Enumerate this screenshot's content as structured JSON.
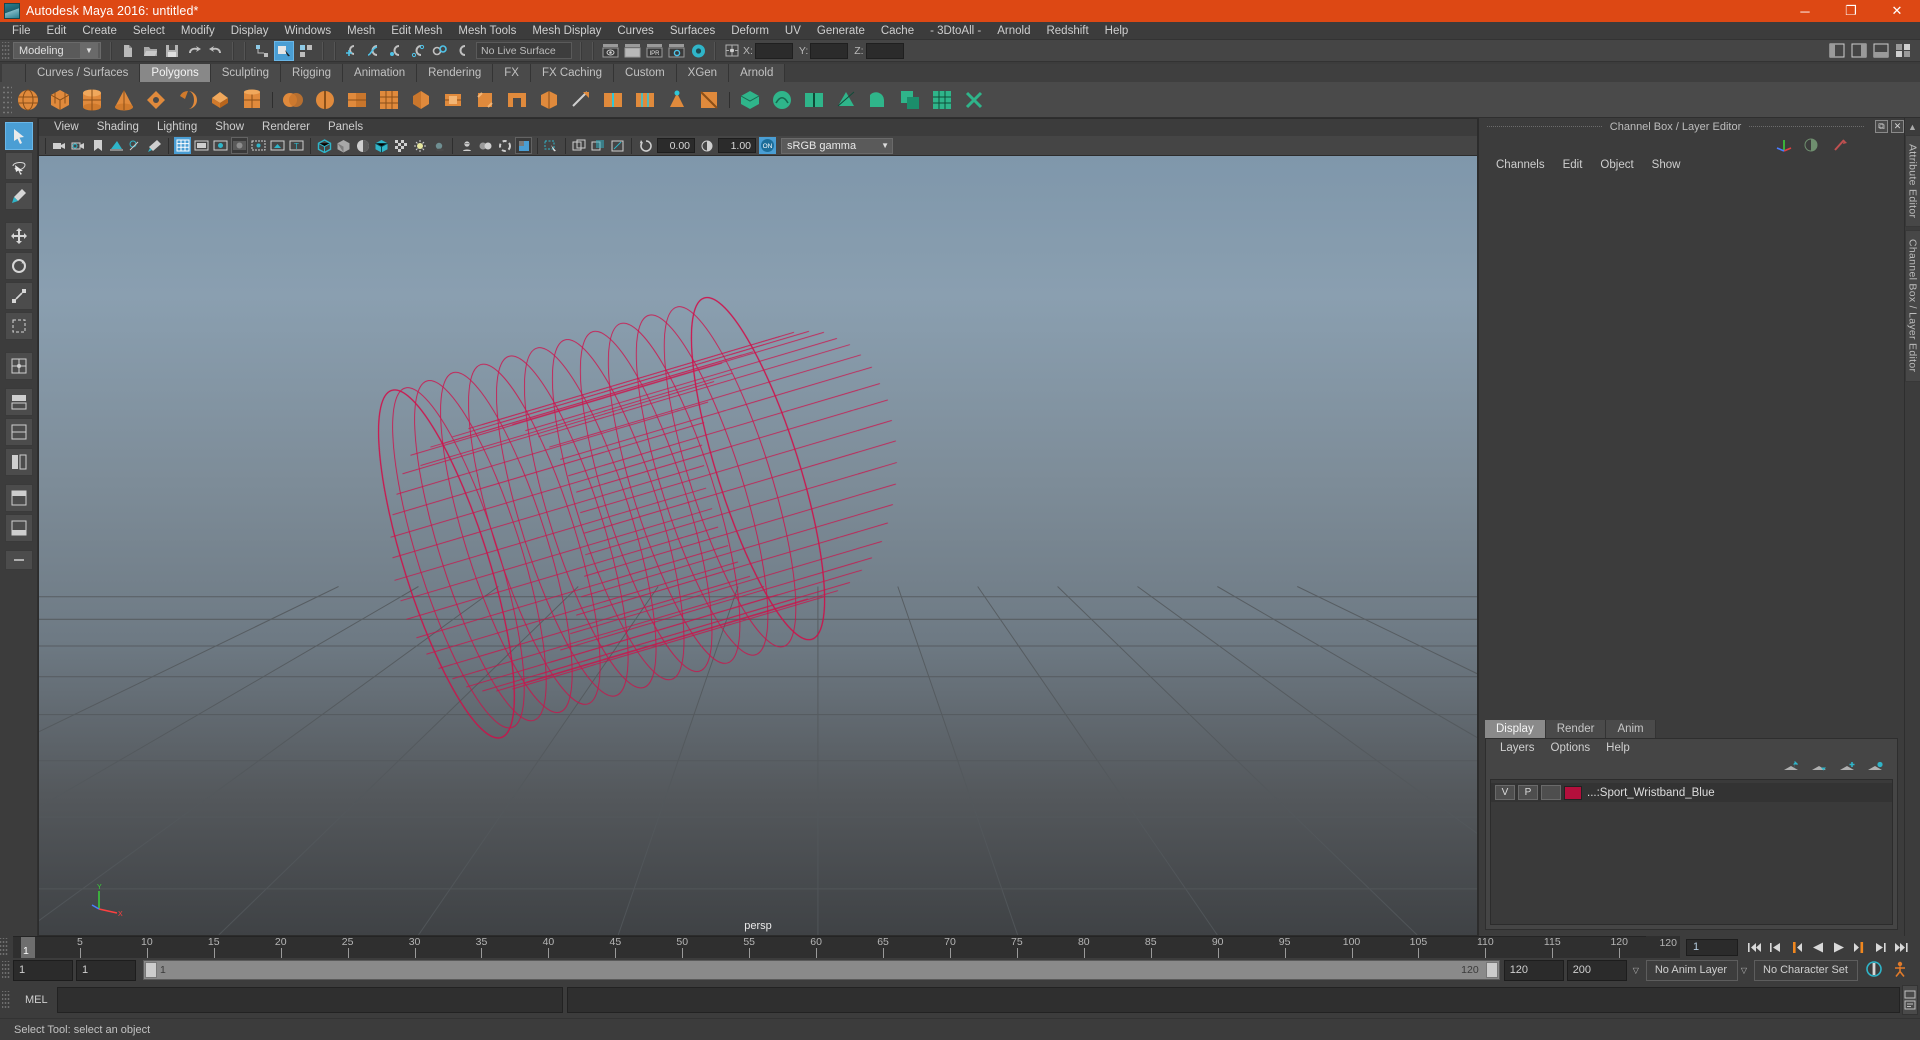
{
  "window": {
    "title": "Autodesk Maya 2016: untitled*",
    "app_icon": "maya-logo-icon",
    "controls": {
      "minimize": "─",
      "maximize": "❐",
      "close": "✕"
    },
    "accent_color": "#dd4814"
  },
  "menubar": {
    "items": [
      "File",
      "Edit",
      "Create",
      "Select",
      "Modify",
      "Display",
      "Windows",
      "Mesh",
      "Edit Mesh",
      "Mesh Tools",
      "Mesh Display",
      "Curves",
      "Surfaces",
      "Deform",
      "UV",
      "Generate",
      "Cache",
      "- 3DtoAll -",
      "Arnold",
      "Redshift",
      "Help"
    ]
  },
  "statusline": {
    "mode": "Modeling",
    "mode_caret": "▼",
    "live_surface": "No Live Surface",
    "coord_labels": {
      "x": "X:",
      "y": "Y:",
      "z": "Z:"
    },
    "coord_values": {
      "x": "",
      "y": "",
      "z": ""
    },
    "icons": [
      "new-scene-icon",
      "open-scene-icon",
      "save-scene-icon",
      "undo-icon",
      "redo-icon",
      "select-by-hierarchy-icon",
      "select-by-object-icon",
      "select-by-component-icon",
      "snap-to-grid-icon",
      "snap-to-curve-icon",
      "snap-to-point-icon",
      "snap-to-projected-center-icon",
      "snap-to-view-plane-icon",
      "make-live-icon",
      "render-current-frame-icon",
      "render-sequence-icon",
      "ipr-render-icon",
      "render-settings-icon",
      "hypershade-icon",
      "input-output-connections-icon"
    ],
    "right_icons": [
      "show-hide-modeling-toolkit-icon",
      "show-hide-attribute-editor-icon",
      "show-hide-tool-settings-icon",
      "show-hide-channel-box-icon"
    ]
  },
  "shelf": {
    "tabs": [
      "Curves / Surfaces",
      "Polygons",
      "Sculpting",
      "Rigging",
      "Animation",
      "Rendering",
      "FX",
      "FX Caching",
      "Custom",
      "XGen",
      "Arnold"
    ],
    "active_tab": "Polygons",
    "buttons": [
      "polygon-sphere-icon",
      "polygon-cube-icon",
      "polygon-cylinder-icon",
      "polygon-cone-icon",
      "polygon-torus-icon",
      "polygon-plane-icon",
      "polygon-pyramid-icon",
      "polygon-prism-icon",
      "polygon-pipe-icon",
      "polygon-helix-icon",
      "polygon-soccer-ball-icon",
      "polygon-platonic-icon",
      "combine-icon",
      "separate-icon",
      "booleans-icon",
      "smooth-icon",
      "mirror-icon",
      "extrude-icon",
      "bevel-icon",
      "bridge-icon",
      "append-to-polygon-icon",
      "fill-hole-icon",
      "multi-cut-icon",
      "target-weld-icon",
      "connect-icon",
      "insert-edge-loop-icon",
      "offset-edge-loop-icon",
      "quad-draw-icon",
      "sculpt-icon",
      "slide-edge-icon",
      "crease-icon",
      "spin-edge-icon",
      "wedge-icon",
      "duplicate-face-icon"
    ]
  },
  "toolbox": {
    "items": [
      "select-tool-icon",
      "lasso-select-tool-icon",
      "paint-select-tool-icon",
      "move-tool-icon",
      "rotate-tool-icon",
      "scale-tool-icon",
      "last-tool-used-icon",
      "four-view-layout-icon",
      "persp-outliner-layout-icon",
      "persp-graph-layout-icon",
      "persp-hypershade-layout-icon",
      "two-pane-side-layout-icon",
      "single-perspective-layout-icon",
      "more-layouts-icon"
    ],
    "selected": "select-tool-icon"
  },
  "viewport": {
    "menus": [
      "View",
      "Shading",
      "Lighting",
      "Show",
      "Renderer",
      "Panels"
    ],
    "camera_label": "persp",
    "toolbar": {
      "icons": [
        "select-camera-icon",
        "camera-attributes-icon",
        "bookmark-icon",
        "image-plane-icon",
        "two-sided-lighting-icon",
        "paint-effects-icon",
        "grid-icon",
        "film-gate-icon",
        "resolution-gate-icon",
        "gate-mask-icon",
        "film-origin-icon",
        "safe-action-icon",
        "safe-title-icon",
        "wireframe-icon",
        "smooth-shade-all-icon",
        "shade-options-icon",
        "wireframe-on-shaded-icon",
        "texture-icon",
        "lighting-icon",
        "shadows-icon",
        "screen-space-ao-icon",
        "motion-blur-icon",
        "multisample-aa-icon",
        "depth-of-field-icon",
        "isolate-select-icon",
        "xray-icon",
        "xray-joints-icon",
        "xray-active-components-icon"
      ],
      "exposure_value": "0.00",
      "gamma_value": "1.00",
      "color_management_toggle": "ON",
      "view_transform": "sRGB gamma",
      "view_transform_caret": "▼"
    },
    "model": {
      "name": "Sport_Wristband_Blue",
      "display": "wireframe",
      "wire_color": "#d1104a",
      "shape": "cylinder-wireframe"
    },
    "axis_gizmo": {
      "y": "Y",
      "x": "X",
      "z": "Z"
    }
  },
  "right_dock": {
    "panel_title": "Channel Box / Layer Editor",
    "window_buttons": [
      "undock-icon",
      "close-icon"
    ],
    "top_icons": [
      "move-axis-icon",
      "half-circle-icon",
      "red-arrow-icon"
    ],
    "channel_menu": [
      "Channels",
      "Edit",
      "Object",
      "Show"
    ],
    "vertical_tabs": [
      "Attribute Editor",
      "Channel Box / Layer Editor"
    ],
    "layer_editor": {
      "tabs": [
        "Display",
        "Render",
        "Anim"
      ],
      "active_tab": "Display",
      "menus": [
        "Layers",
        "Options",
        "Help"
      ],
      "buttons": [
        "move-layer-up-icon",
        "move-layer-down-icon",
        "new-layer-icon",
        "new-layer-from-selected-icon"
      ],
      "layers": [
        {
          "visibility": "V",
          "playback": "P",
          "shading": "",
          "color": "#b40f3c",
          "name": "...:Sport_Wristband_Blue"
        }
      ]
    }
  },
  "timeline": {
    "ticks": [
      5,
      10,
      15,
      20,
      25,
      30,
      35,
      40,
      45,
      50,
      55,
      60,
      65,
      70,
      75,
      80,
      85,
      90,
      95,
      100,
      105,
      110,
      115,
      120
    ],
    "current_frame": "1",
    "current_frame_field": "1",
    "end_marker": "120",
    "playback_buttons": [
      "go-to-start-icon",
      "step-back-frame-icon",
      "step-back-key-icon",
      "play-backwards-icon",
      "play-forwards-icon",
      "step-forward-key-icon",
      "step-forward-frame-icon",
      "go-to-end-icon"
    ]
  },
  "range_slider": {
    "anim_start": "1",
    "range_start": "1",
    "bar_start_label": "1",
    "bar_end_label": "120",
    "range_end": "120",
    "anim_end": "200",
    "anim_layer": "No Anim Layer",
    "character_set": "No Character Set",
    "caret": "▽",
    "right_icons": [
      "auto-keyframe-icon",
      "animation-preferences-icon"
    ]
  },
  "command_line": {
    "label": "MEL",
    "input_value": "",
    "output_value": "",
    "script-editor-button": "script-editor-icon"
  },
  "status_bar": {
    "help_text": "Select Tool: select an object"
  }
}
